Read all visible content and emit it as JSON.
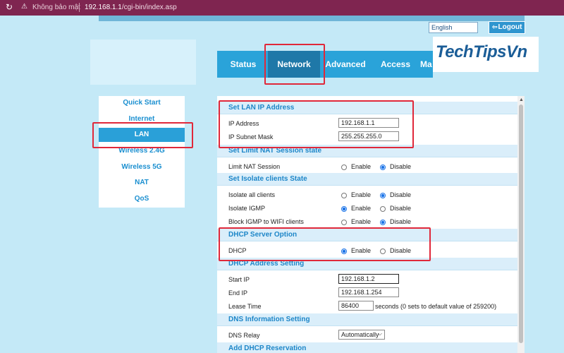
{
  "browser": {
    "security_label": "Không bảo mật",
    "url_host": "192.168.1.1",
    "url_path": "/cgi-bin/index.asp"
  },
  "header": {
    "language": "English",
    "logout_label": "Logout",
    "watermark": "TechTipsVn"
  },
  "nav": {
    "tabs": [
      {
        "label": "Status"
      },
      {
        "label": "Network"
      },
      {
        "label": "Advanced"
      },
      {
        "label": "Access"
      },
      {
        "label": "Ma"
      }
    ],
    "active": "Network"
  },
  "sidebar": {
    "items": [
      {
        "label": "Quick Start"
      },
      {
        "label": "Internet"
      },
      {
        "label": "LAN"
      },
      {
        "label": "Wireless 2.4G"
      },
      {
        "label": "Wireless 5G"
      },
      {
        "label": "NAT"
      },
      {
        "label": "QoS"
      }
    ],
    "active": "LAN"
  },
  "lan": {
    "title": "Set LAN IP Address",
    "ip_label": "IP Address",
    "ip_value": "192.168.1.1",
    "mask_label": "IP Subnet Mask",
    "mask_value": "255.255.255.0"
  },
  "nat_session": {
    "title": "Set Limit NAT Session state",
    "label": "Limit NAT Session",
    "enable": "Enable",
    "disable": "Disable",
    "selected": "Disable"
  },
  "isolate": {
    "title": "Set Isolate clients State",
    "rows": [
      {
        "label": "Isolate all clients",
        "enable": "Enable",
        "disable": "Disable",
        "selected": "Disable"
      },
      {
        "label": "Isolate IGMP",
        "enable": "Enable",
        "disable": "Disable",
        "selected": "Enable"
      },
      {
        "label": "Block IGMP to WIFI clients",
        "enable": "Enable",
        "disable": "Disable",
        "selected": "Disable"
      }
    ]
  },
  "dhcp": {
    "title": "DHCP Server Option",
    "label": "DHCP",
    "enable": "Enable",
    "disable": "Disable",
    "selected": "Enable"
  },
  "dhcp_address": {
    "title": "DHCP Address Setting",
    "start_label": "Start IP",
    "start_value": "192.168.1.2",
    "end_label": "End IP",
    "end_value": "192.168.1.254",
    "lease_label": "Lease Time",
    "lease_value": "86400",
    "lease_note": "seconds (0 sets to default value of 259200)"
  },
  "dns": {
    "title": "DNS Information Setting",
    "relay_label": "DNS Relay",
    "relay_value": "Automatically"
  },
  "reservation": {
    "title": "Add DHCP Reservation"
  },
  "colors": {
    "page_bg": "#c4e9f7",
    "nav_bg": "#2aa3d9",
    "nav_active": "#1f78a8",
    "highlight": "#e0283a",
    "section_text": "#1d86c8"
  }
}
